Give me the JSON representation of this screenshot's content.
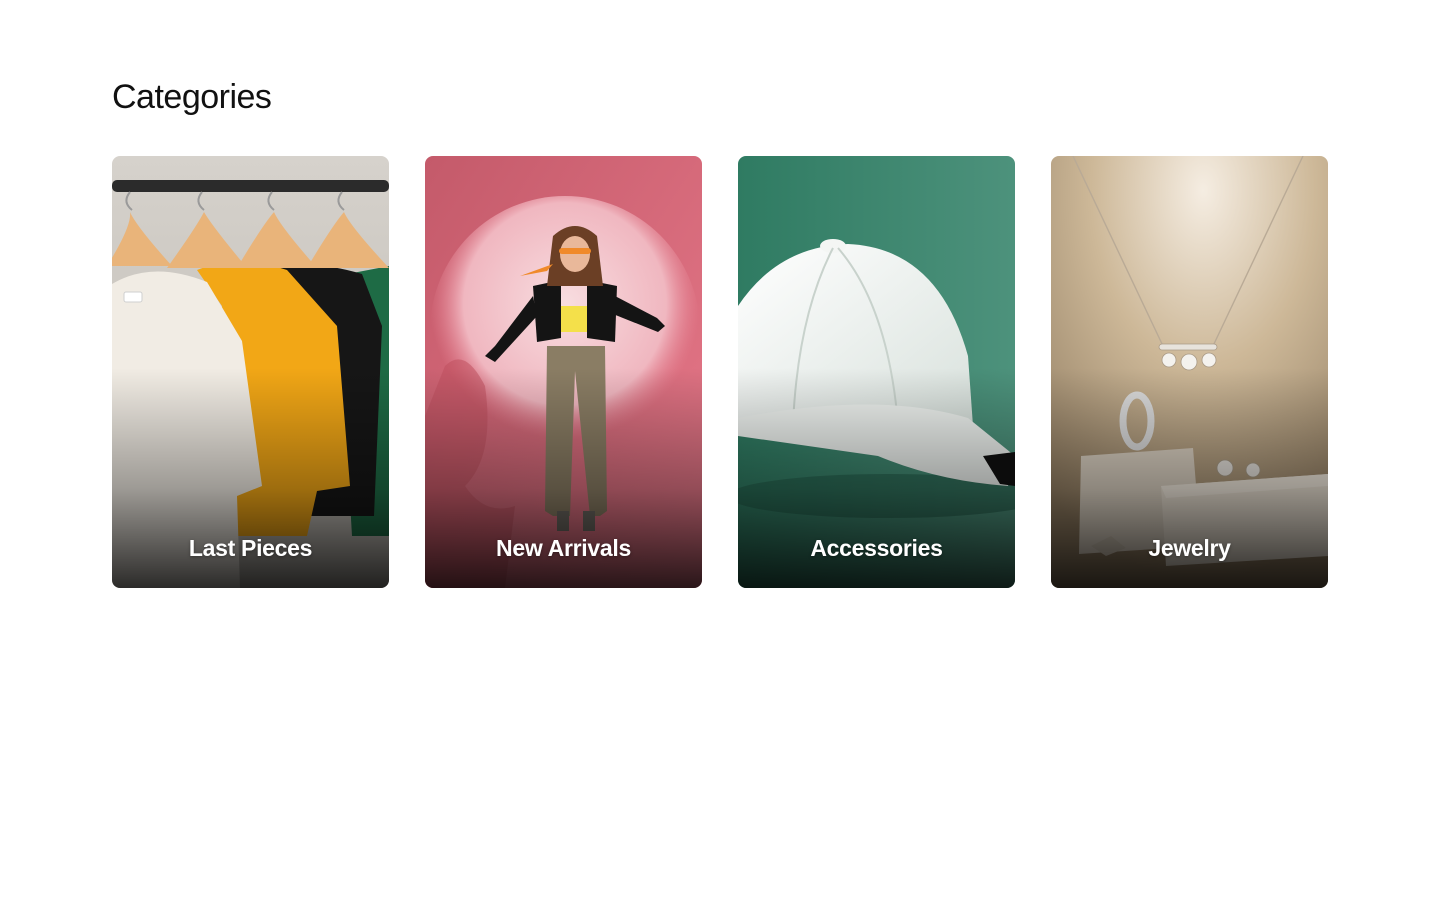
{
  "section": {
    "title": "Categories"
  },
  "categories": [
    {
      "label": "Last Pieces",
      "image": "hanging-tshirts-image"
    },
    {
      "label": "New Arrivals",
      "image": "fashion-model-image"
    },
    {
      "label": "Accessories",
      "image": "white-cap-image"
    },
    {
      "label": "Jewelry",
      "image": "necklace-ring-image"
    }
  ],
  "colors": {
    "background": "#ffffff",
    "title_text": "#111111",
    "card_label_text": "#ffffff",
    "accessories_backdrop": "#3f8a70",
    "new_arrivals_backdrop": "#e3707f",
    "jewelry_backdrop": "#b59f7f"
  }
}
